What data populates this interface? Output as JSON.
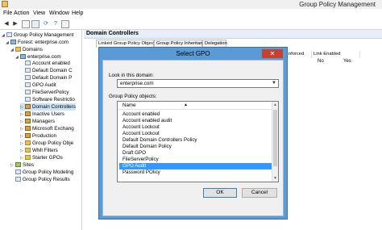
{
  "window": {
    "title": "Group Policy Management"
  },
  "menu": [
    "File",
    "Action",
    "View",
    "Window",
    "Help"
  ],
  "tree": {
    "root": "Group Policy Management",
    "forest": "Forest: enterprise.com",
    "domains": "Domains",
    "domain": "enterprise.com",
    "children": [
      "Account enabled",
      "Default Domain C",
      "Default Domain P",
      "GPO Audit",
      "FileServerPolicy",
      "Software Restrictio",
      "Domain Controllers",
      "Inactive Users",
      "Managers",
      "Microsoft Exchang",
      "Production",
      "Group Policy Obje",
      "WMI Filters",
      "Starter GPOs"
    ],
    "sites": "Sites",
    "modeling": "Group Policy Modeling",
    "results": "Group Policy Results"
  },
  "right": {
    "header": "Domain Controllers",
    "tabs": [
      "Linked Group Policy Objects",
      "Group Policy Inheritance",
      "Delegation"
    ],
    "columns": [
      "Enforced",
      "Link Enabled"
    ],
    "row": [
      "No",
      "Yes"
    ]
  },
  "dialog": {
    "title": "Select GPO",
    "close": "✕",
    "domain_label": "Look in this domain:",
    "domain_value": "enterprise.com",
    "list_label": "Group Policy objects:",
    "list_header": "Name",
    "items": [
      "Account enabled",
      "Account enabled audit",
      "Account Lockout",
      "Account Lockout",
      "Default Domain Controllers Policy",
      "Default Domain Policy",
      "Draft GPO",
      "FileServerPolicy",
      "GPO Audit",
      "Password POlicy"
    ],
    "selected_index": 8,
    "ok": "OK",
    "cancel": "Cancel"
  }
}
